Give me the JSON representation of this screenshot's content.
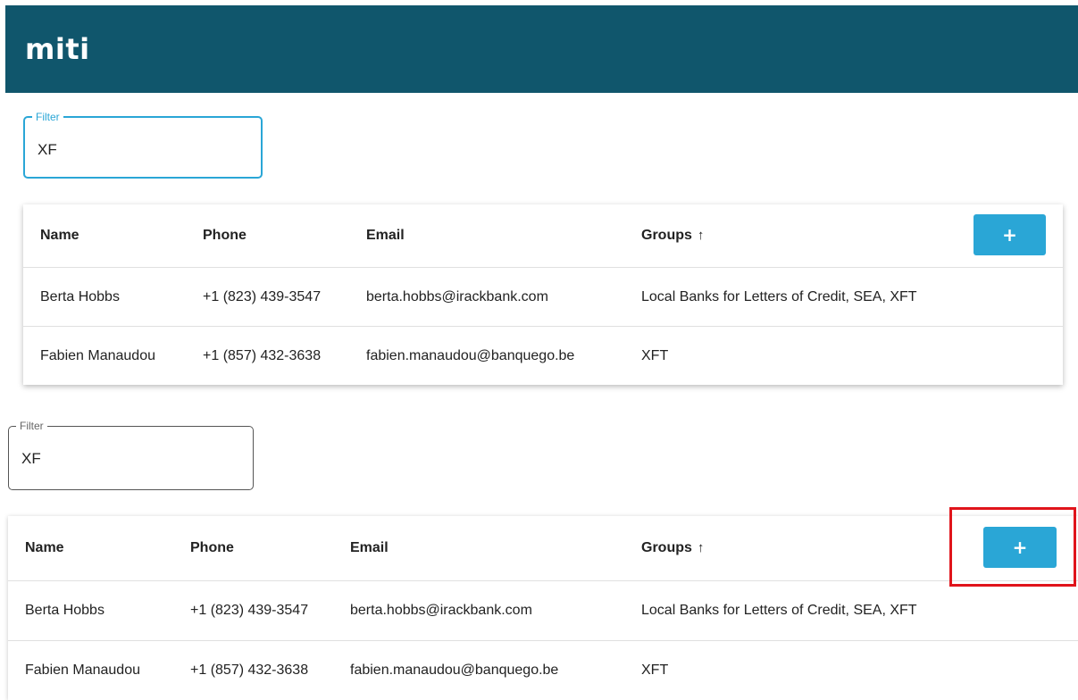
{
  "header": {
    "logo_text": "miti",
    "background_color": "#10566c"
  },
  "accent_color": "#2aa6d6",
  "highlight_color": "#e0141b",
  "panels": [
    {
      "filter": {
        "label": "Filter",
        "value": "XF",
        "state": "focused"
      },
      "table": {
        "columns": [
          "Name",
          "Phone",
          "Email",
          "Groups"
        ],
        "sorted_column": "Groups",
        "sort_icon": "arrow-up-icon",
        "sort_glyph": "↑",
        "add_button_glyph": "+",
        "add_button_icon": "plus-icon",
        "rows": [
          {
            "name": "Berta Hobbs",
            "phone": "+1 (823) 439-3547",
            "email": "berta.hobbs@irackbank.com",
            "groups": "Local Banks for Letters of Credit, SEA, XFT"
          },
          {
            "name": "Fabien Manaudou",
            "phone": "+1 (857) 432-3638",
            "email": "fabien.manaudou@banquego.be",
            "groups": "XFT"
          }
        ]
      }
    },
    {
      "filter": {
        "label": "Filter",
        "value": "XF",
        "state": "default"
      },
      "table": {
        "columns": [
          "Name",
          "Phone",
          "Email",
          "Groups"
        ],
        "sorted_column": "Groups",
        "sort_icon": "arrow-up-icon",
        "sort_glyph": "↑",
        "add_button_glyph": "+",
        "add_button_icon": "plus-icon",
        "highlighted": true,
        "rows": [
          {
            "name": "Berta Hobbs",
            "phone": "+1 (823) 439-3547",
            "email": "berta.hobbs@irackbank.com",
            "groups": "Local Banks for Letters of Credit, SEA, XFT"
          },
          {
            "name": "Fabien Manaudou",
            "phone": "+1 (857) 432-3638",
            "email": "fabien.manaudou@banquego.be",
            "groups": "XFT"
          }
        ]
      }
    }
  ]
}
